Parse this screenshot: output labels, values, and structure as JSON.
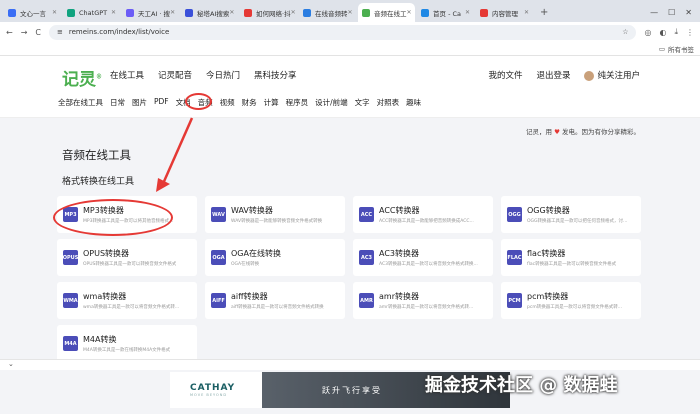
{
  "browser": {
    "tabs": [
      {
        "label": "文心一言",
        "color": "#3b6ef5"
      },
      {
        "label": "ChatGPT",
        "color": "#10a37f"
      },
      {
        "label": "天工AI · 搜",
        "color": "#6b5cf6"
      },
      {
        "label": "秘塔AI搜索",
        "color": "#3a50d9"
      },
      {
        "label": "如何网络·抖",
        "color": "#e53935"
      },
      {
        "label": "在线音频转",
        "color": "#2a7de1"
      },
      {
        "label": "音频在线工",
        "color": "#4caf50"
      },
      {
        "label": "首页 - Ca",
        "color": "#1e88e5"
      },
      {
        "label": "内容管理",
        "color": "#e53935"
      }
    ],
    "new_tab": "+",
    "minimize": "—",
    "maximize": "☐",
    "close": "✕",
    "back": "←",
    "forward": "→",
    "reload": "C",
    "url": "remeins.com/index/list/voice",
    "star": "☆",
    "bookmarks_label": "所有书签"
  },
  "site": {
    "logo": "记灵",
    "logo_mark": "®",
    "nav_main": [
      "在线工具",
      "记灵配音",
      "今日热门",
      "黑科技分享"
    ],
    "nav_right": [
      "我的文件",
      "退出登录"
    ],
    "user": "纯关注用户",
    "nav_sub": [
      "全部在线工具",
      "日常",
      "图片",
      "PDF",
      "文档",
      "音频",
      "视频",
      "财务",
      "计算",
      "程序员",
      "设计/前端",
      "文字",
      "对照表",
      "趣味"
    ],
    "slogan_pre": "记灵，用",
    "slogan_heart": "♥",
    "slogan_post": "发电。因为有你分享精彩。"
  },
  "main": {
    "title": "音频在线工具",
    "section": "格式转换在线工具",
    "cards": [
      {
        "icon": "MP3",
        "title": "MP3转换器",
        "desc": "MP3转换器工具是一款可以将其他音频格式..."
      },
      {
        "icon": "WAV",
        "title": "WAV转换器",
        "desc": "WAV转换器是一款能够转换音频文件格式转换"
      },
      {
        "icon": "ACC",
        "title": "ACC转换器",
        "desc": "ACC转换器工具是一款能够把音频转换成ACC..."
      },
      {
        "icon": "OGG",
        "title": "OGG转换器",
        "desc": "OGG转换器工具是一款可以把任何音频格式，讨..."
      },
      {
        "icon": "OPUS",
        "title": "OPUS转换器",
        "desc": "OPUS转换器工具是一款可以转换音频文件格式"
      },
      {
        "icon": "OGA",
        "title": "OGA在线转换",
        "desc": "OGA在线转换"
      },
      {
        "icon": "AC3",
        "title": "AC3转换器",
        "desc": "AC3转换器工具是一款可以将音频文件格式转换..."
      },
      {
        "icon": "FLAC",
        "title": "flac转换器",
        "desc": "flac转换器工具是一款可以转换音频文件格式"
      },
      {
        "icon": "WMA",
        "title": "wma转换器",
        "desc": "wma转换器工具是一款可以将音频文件格式转..."
      },
      {
        "icon": "AIFF",
        "title": "aiff转换器",
        "desc": "aiff转换器工具是一款可以将音频文件格式转换"
      },
      {
        "icon": "AMR",
        "title": "amr转换器",
        "desc": "amr转换器工具是一款可以将音频文件格式转..."
      },
      {
        "icon": "PCM",
        "title": "pcm转换器",
        "desc": "pcm转换器工具是一款可以将音频文件格式转..."
      },
      {
        "icon": "M4A",
        "title": "M4A转换",
        "desc": "M4A转换工具是一款在线转换M4A文件格式"
      }
    ]
  },
  "bottom": {
    "chevron": "⌄"
  },
  "ad": {
    "brand": "CATHAY",
    "brand_sub": "MOVE BEYOND",
    "tagline": "跃升飞行享受",
    "close": "✕"
  },
  "watermark": "掘金技术社区 @ 数据蛙",
  "colors": {
    "accent": "#4caf50",
    "annotation": "#e53935",
    "icon_bg": "#4b4db8"
  }
}
